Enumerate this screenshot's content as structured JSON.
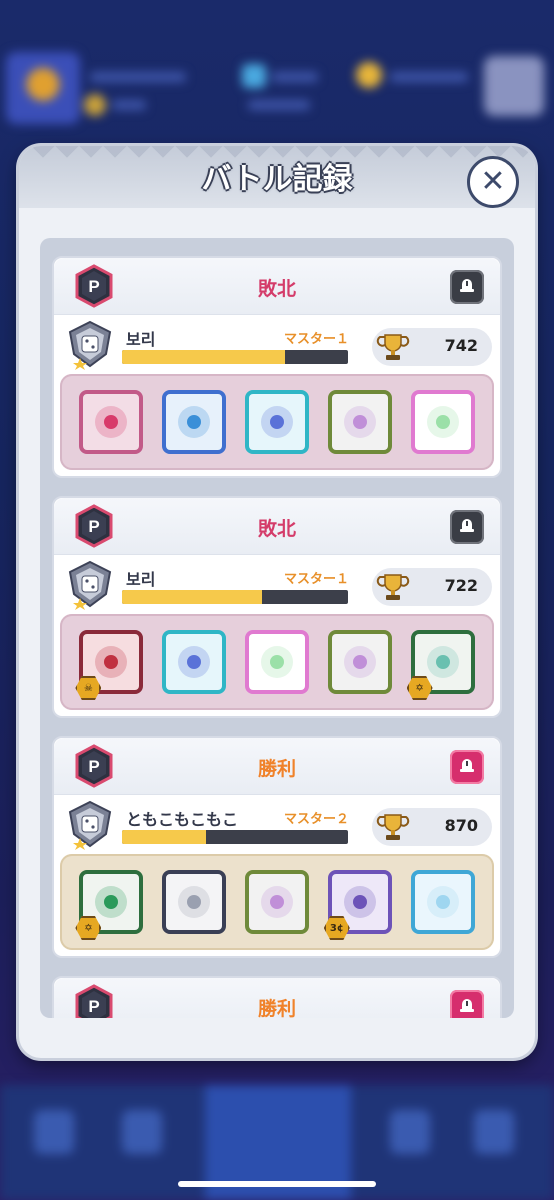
{
  "modal": {
    "title": "バトル記録",
    "close_icon": "close-icon"
  },
  "colors": {
    "loss": "#d43c6a",
    "win": "#f0822a",
    "xp_fill": "#f6c94b"
  },
  "records": [
    {
      "result": "敗北",
      "result_type": "loss",
      "alert_style": "dark",
      "player": "보리",
      "rank": "マスター１",
      "xp_progress": 0.72,
      "trophies": "742",
      "dice": [
        {
          "name": "sword-dice",
          "border": "#c25a88",
          "bg": "#f3dde6",
          "pip": "#d93a6a"
        },
        {
          "name": "wind-dice",
          "border": "#3f6fcf",
          "bg": "#e7f1fb",
          "pip": "#3a8fd8"
        },
        {
          "name": "water-dice",
          "border": "#2fb6c6",
          "bg": "#e6f6fb",
          "pip": "#5a72d8"
        },
        {
          "name": "infinity-dice",
          "border": "#6f8a3a",
          "bg": "#f2f2f2",
          "pip": "#c08fd8"
        },
        {
          "name": "rainbow-dice",
          "border": "#e07ad0",
          "bg": "#ffffff",
          "pip": "#9be0a8"
        }
      ]
    },
    {
      "result": "敗北",
      "result_type": "loss",
      "alert_style": "dark",
      "player": "보리",
      "rank": "マスター１",
      "xp_progress": 0.62,
      "trophies": "722",
      "dice": [
        {
          "name": "curse-dice",
          "border": "#8a2a3a",
          "bg": "#f6dde0",
          "pip": "#c03040",
          "badge": "skull"
        },
        {
          "name": "water-dice",
          "border": "#2fb6c6",
          "bg": "#e6f6fb",
          "pip": "#5a72d8"
        },
        {
          "name": "rainbow-dice",
          "border": "#e07ad0",
          "bg": "#ffffff",
          "pip": "#9be0a8"
        },
        {
          "name": "infinity-dice",
          "border": "#6f8a3a",
          "bg": "#f2f2f2",
          "pip": "#c08fd8"
        },
        {
          "name": "summoner-dice",
          "border": "#2e6e3e",
          "bg": "#f0f4f0",
          "pip": "#6ac0b0",
          "badge": "star"
        }
      ]
    },
    {
      "result": "勝利",
      "result_type": "win",
      "alert_style": "pink",
      "player": "ともこもこもこ",
      "rank": "マスター２",
      "xp_progress": 0.37,
      "trophies": "870",
      "dice": [
        {
          "name": "summoner-dice",
          "border": "#2e6e3e",
          "bg": "#f0f4f0",
          "pip": "#2a9a5a",
          "badge": "star"
        },
        {
          "name": "sword-dice",
          "border": "#3a3f55",
          "bg": "#f4f4f6",
          "pip": "#9aa0b0"
        },
        {
          "name": "infinity-dice",
          "border": "#6f8a3a",
          "bg": "#f2f2f2",
          "pip": "#c08fd8"
        },
        {
          "name": "time-dice",
          "border": "#6d53b8",
          "bg": "#eee8f8",
          "pip": "#6d53b8",
          "badge": "3"
        },
        {
          "name": "crystal-dice",
          "border": "#3fa7d6",
          "bg": "#eaf6fd",
          "pip": "#9fd6f0"
        }
      ]
    },
    {
      "result": "勝利",
      "result_type": "win",
      "alert_style": "pink"
    }
  ]
}
